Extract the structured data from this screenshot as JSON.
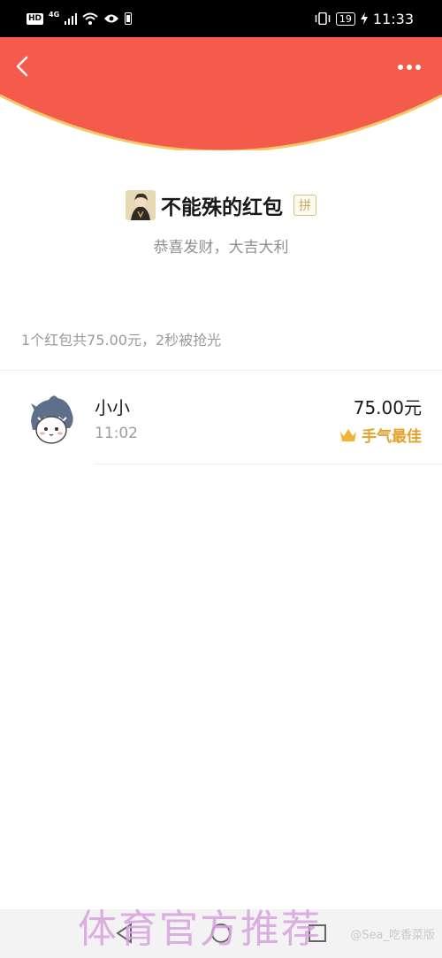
{
  "status_bar": {
    "hd": "HD",
    "network": "4G",
    "battery": "19",
    "time": "11:33"
  },
  "header": {
    "background_color": "#f45b4b",
    "back_icon": "chevron-left-icon",
    "more_icon": "more-dots-icon"
  },
  "envelope": {
    "sender_name": "不能殊的红包",
    "pin_label": "拼",
    "greeting": "恭喜发财，大吉大利"
  },
  "summary": {
    "text": "1个红包共75.00元，2秒被抢光"
  },
  "records": [
    {
      "name": "小小",
      "time": "11:02",
      "amount": "75.00元",
      "badge": "手气最佳",
      "badge_icon": "crown-icon"
    }
  ],
  "watermark": {
    "text": "体育官方推荐",
    "weibo": "@Sea_吃香菜版"
  }
}
